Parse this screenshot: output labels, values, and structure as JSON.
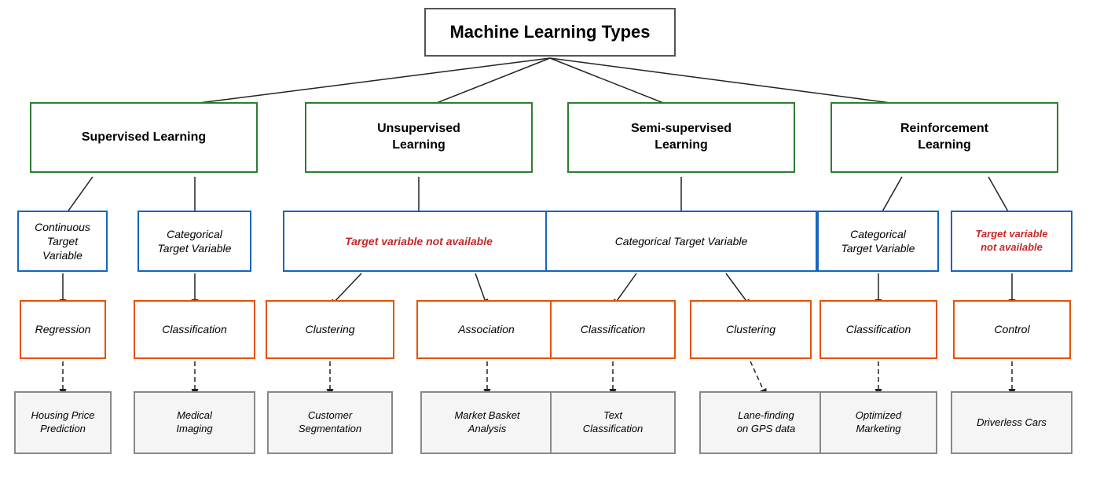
{
  "title": "Machine Learning Types",
  "nodes": {
    "root": {
      "label": "Machine Learning Types"
    },
    "supervised": {
      "label": "Supervised Learning"
    },
    "unsupervised": {
      "label": "Unsupervised\nLearning"
    },
    "semi": {
      "label": "Semi-supervised\nLearning"
    },
    "reinforcement": {
      "label": "Reinforcement\nLearning"
    },
    "continuous": {
      "label": "Continuous\nTarget Variable"
    },
    "categorical_sup": {
      "label": "Categorical\nTarget Variable"
    },
    "target_not_avail": {
      "label": "Target variable not available"
    },
    "categorical_semi": {
      "label": "Categorical Target Variable"
    },
    "categorical_rein": {
      "label": "Categorical\nTarget Variable"
    },
    "target_not_avail2": {
      "label": "Target variable\nnot available"
    },
    "regression": {
      "label": "Regression"
    },
    "classification_sup": {
      "label": "Classification"
    },
    "clustering_unsup": {
      "label": "Clustering"
    },
    "association": {
      "label": "Association"
    },
    "classification_semi": {
      "label": "Classification"
    },
    "clustering_semi": {
      "label": "Clustering"
    },
    "classification_rein": {
      "label": "Classification"
    },
    "control": {
      "label": "Control"
    },
    "housing": {
      "label": "Housing Price\nPrediction"
    },
    "medical": {
      "label": "Medical\nImaging"
    },
    "customer": {
      "label": "Customer\nSegmentation"
    },
    "market": {
      "label": "Market Basket\nAnalysis"
    },
    "text_class": {
      "label": "Text\nClassification"
    },
    "lane": {
      "label": "Lane-finding\non GPS data"
    },
    "optimized": {
      "label": "Optimized\nMarketing"
    },
    "driverless": {
      "label": "Driverless Cars"
    }
  }
}
